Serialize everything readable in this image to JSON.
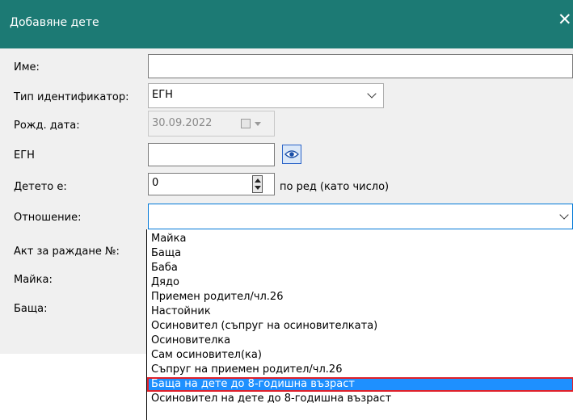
{
  "window": {
    "title": "Добавяне дете",
    "close_glyph": "✕"
  },
  "form": {
    "name_label": "Име:",
    "name_value": "",
    "id_type_label": "Тип идентификатор:",
    "id_type_value": "ЕГН",
    "birth_label": "Рожд. дата:",
    "birth_value": "30.09.2022",
    "egn_label": "ЕГН",
    "egn_value": "",
    "child_order_label": "Детето е:",
    "child_order_value": "0",
    "child_order_suffix": "по ред (като число)",
    "relation_label": "Отношение:",
    "relation_value": "",
    "birth_act_label": "Акт за раждане №:",
    "mother_label": "Майка:",
    "father_label": "Баща:"
  },
  "relation_options": [
    "Майка",
    "Баща",
    "Баба",
    "Дядо",
    "Приемен родител/чл.26",
    "Настойник",
    "Осиновител (съпруг на осиновителката)",
    "Осиновителка",
    "Сам осиновител(ка)",
    "Съпруг на приемен родител/чл.26",
    "Баща на дете до 8-годишна възраст",
    "Осиновител на дете до 8-годишна възраст"
  ],
  "selected_option_index": 10,
  "icons": {
    "close": "close-icon",
    "calendar": "calendar-icon",
    "eye": "eye-icon",
    "dropdown": "chevron-down-icon"
  },
  "colors": {
    "titlebar": "#1c7a74",
    "selection": "#1e90ff",
    "highlight_border": "#e0202a",
    "focus_border": "#0078d7"
  }
}
